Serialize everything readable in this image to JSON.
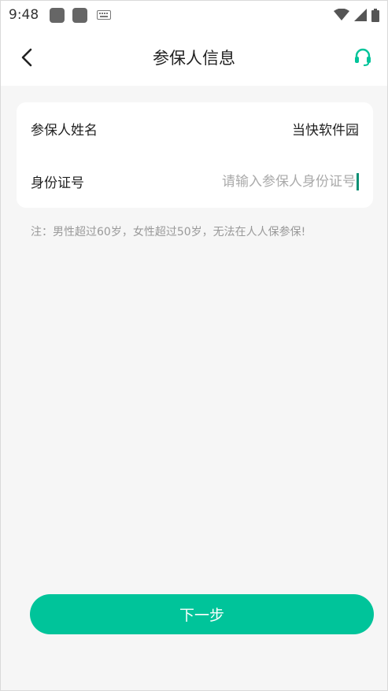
{
  "status_bar": {
    "time": "9:48",
    "icons": [
      "notification-square-icon",
      "notification-square-icon",
      "keyboard-icon",
      "wifi-icon",
      "signal-icon",
      "battery-icon"
    ]
  },
  "header": {
    "title": "参保人信息",
    "back_icon": "back-arrow-icon",
    "support_icon": "headset-icon",
    "accent_color": "#00c49a"
  },
  "form": {
    "name_label": "参保人姓名",
    "name_value": "当快软件园",
    "id_label": "身份证号",
    "id_value": "",
    "id_placeholder": "请输入参保人身份证号"
  },
  "note": "注：男性超过60岁，女性超过50岁，无法在人人保参保!",
  "next_button": {
    "label": "下一步",
    "color": "#00c49a"
  }
}
